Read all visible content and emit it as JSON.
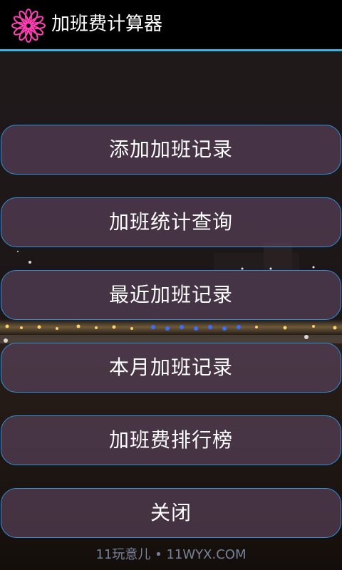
{
  "app": {
    "title": "加班费计算器",
    "icon": "pink-flower-icon"
  },
  "colors": {
    "title_bar": "#000000",
    "accent_line": "#33b5e5",
    "button_border": "#2f8fd8",
    "button_fill": "#564058",
    "icon_color": "#ff3fb4"
  },
  "menu": {
    "items": [
      {
        "label": "添加加班记录"
      },
      {
        "label": "加班统计查询"
      },
      {
        "label": "最近加班记录"
      },
      {
        "label": "本月加班记录"
      },
      {
        "label": "加班费排行榜"
      },
      {
        "label": "关闭"
      }
    ]
  },
  "watermark": {
    "text": "11玩意儿 • 11WYX.COM"
  }
}
